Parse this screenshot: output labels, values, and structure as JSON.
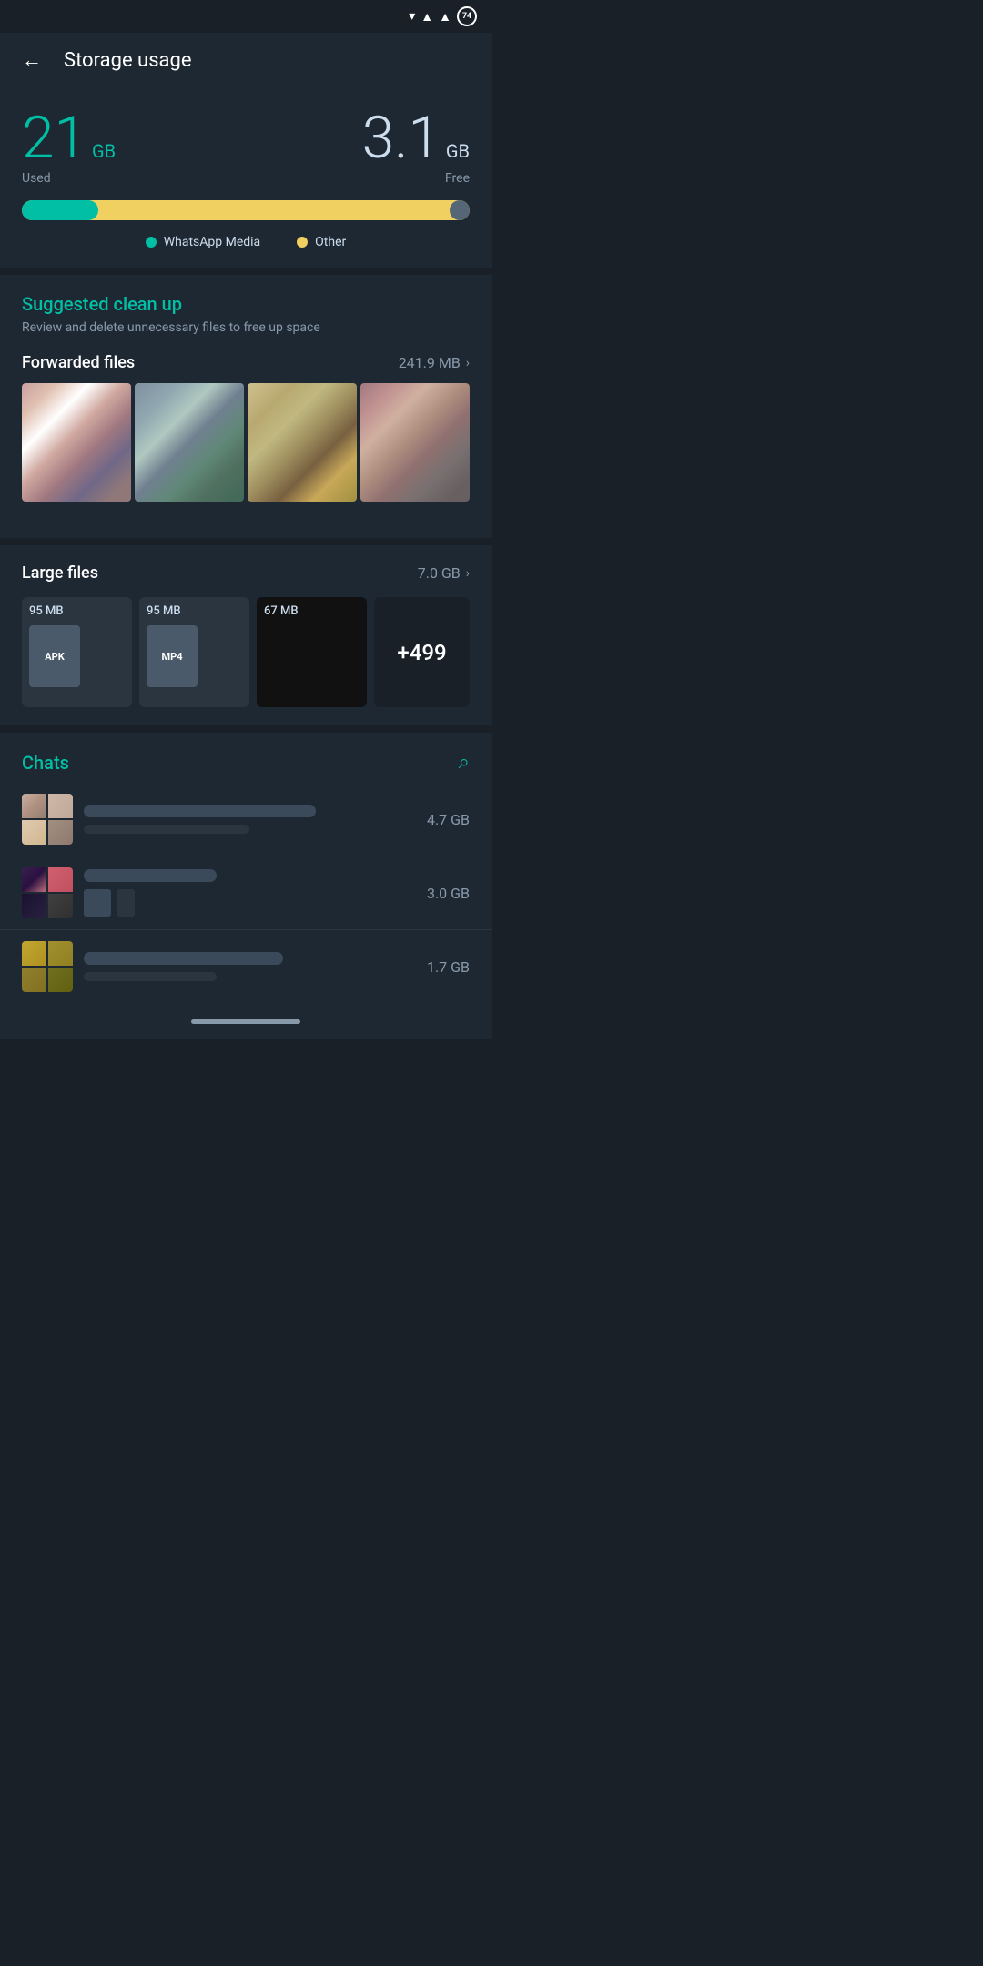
{
  "status_bar": {
    "battery": "74"
  },
  "header": {
    "title": "Storage usage",
    "back_label": "←"
  },
  "storage": {
    "used_num": "21",
    "used_unit": "GB",
    "used_label": "Used",
    "free_num": "3.1",
    "free_unit": "GB",
    "free_label": "Free",
    "progress_pct": 17,
    "legend_media": "WhatsApp Media",
    "legend_other": "Other"
  },
  "cleanup": {
    "title": "Suggested clean up",
    "subtitle": "Review and delete unnecessary files to free up space",
    "forwarded_label": "Forwarded files",
    "forwarded_size": "241.9 MB",
    "large_files_label": "Large files",
    "large_files_size": "7.0 GB",
    "file1_size": "95 MB",
    "file1_type": "APK",
    "file2_size": "95 MB",
    "file2_type": "MP4",
    "file3_size": "67 MB",
    "more_label": "+499"
  },
  "chats": {
    "title": "Chats",
    "item1_size": "4.7 GB",
    "item2_size": "3.0 GB",
    "item3_size": "1.7 GB"
  }
}
